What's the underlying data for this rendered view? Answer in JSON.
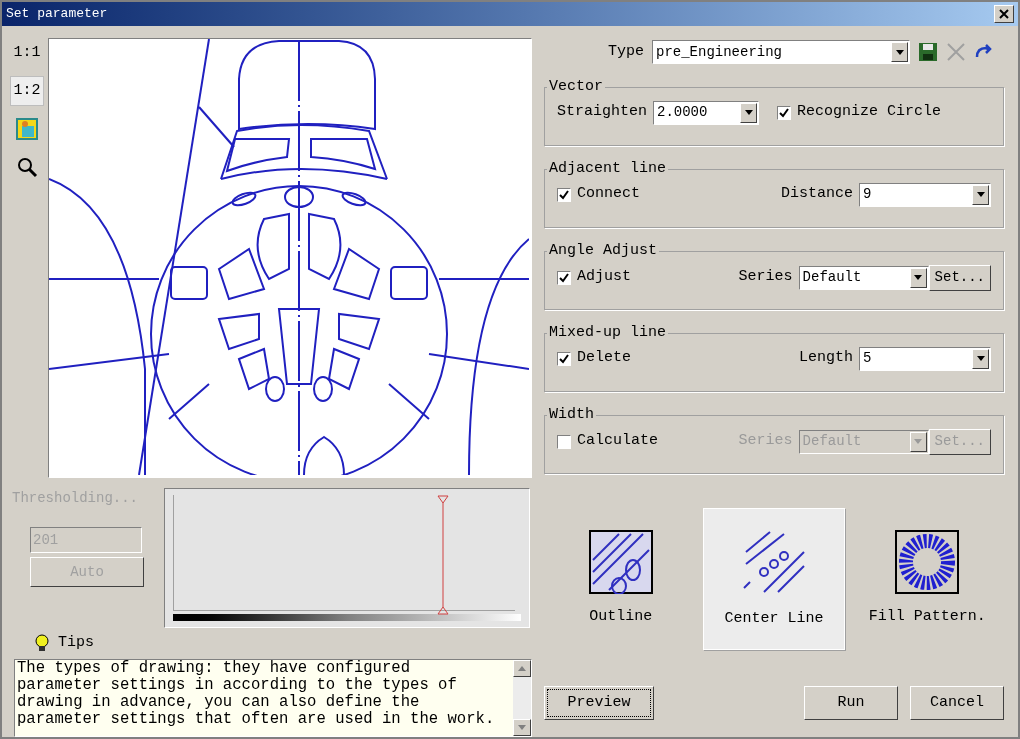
{
  "window": {
    "title": "Set parameter"
  },
  "zoom_tools": [
    {
      "kind": "text",
      "label": "1:1",
      "selected": false
    },
    {
      "kind": "text",
      "label": "1:2",
      "selected": true
    },
    {
      "kind": "image",
      "selected": false
    },
    {
      "kind": "search",
      "selected": false
    }
  ],
  "threshold": {
    "label": "Thresholding...",
    "disabled": true,
    "value": "201",
    "auto_button": "Auto",
    "level": 0.79
  },
  "tips": {
    "title": "Tips",
    "text": "The types of drawing: they have configured parameter settings in according to the types of drawing in advance, you can also define the parameter settings that often are used in the work."
  },
  "type": {
    "label": "Type",
    "value": "pre_Engineering"
  },
  "groups": [
    {
      "title": "Vector",
      "items": [
        {
          "kind": "combo",
          "label": "Straighten",
          "value": "2.0000",
          "disabled": false
        },
        {
          "kind": "checkbox",
          "label": "Recognize Circle",
          "checked": true
        }
      ]
    },
    {
      "title": "Adjacent line",
      "items": [
        {
          "kind": "checkbox",
          "label": "Connect",
          "checked": true
        },
        {
          "kind": "combo",
          "label": "Distance",
          "value": "9",
          "disabled": false
        }
      ]
    },
    {
      "title": "Angle Adjust",
      "items": [
        {
          "kind": "checkbox",
          "label": "Adjust",
          "checked": true
        },
        {
          "kind": "combo",
          "label": "Series",
          "value": "Default",
          "disabled": false
        },
        {
          "kind": "button",
          "label": "Set...",
          "disabled": false
        }
      ]
    },
    {
      "title": "Mixed-up line",
      "items": [
        {
          "kind": "checkbox",
          "label": "Delete",
          "checked": true
        },
        {
          "kind": "combo",
          "label": "Length",
          "value": "5",
          "disabled": false
        }
      ]
    },
    {
      "title": "Width",
      "items": [
        {
          "kind": "checkbox",
          "label": "Calculate",
          "checked": false
        },
        {
          "kind": "combo",
          "label": "Series",
          "value": "Default",
          "disabled": true
        },
        {
          "kind": "button",
          "label": "Set...",
          "disabled": true
        }
      ]
    }
  ],
  "drawing_types": [
    {
      "kind": "outline",
      "label": "Outline",
      "selected": false
    },
    {
      "kind": "centerline",
      "label": "Center Line",
      "selected": true
    },
    {
      "kind": "fill",
      "label": "Fill Pattern.",
      "selected": false
    }
  ],
  "buttons": [
    {
      "label": "Preview",
      "focused": true
    },
    {
      "label": "Run",
      "focused": false
    },
    {
      "label": "Cancel",
      "focused": false
    }
  ]
}
